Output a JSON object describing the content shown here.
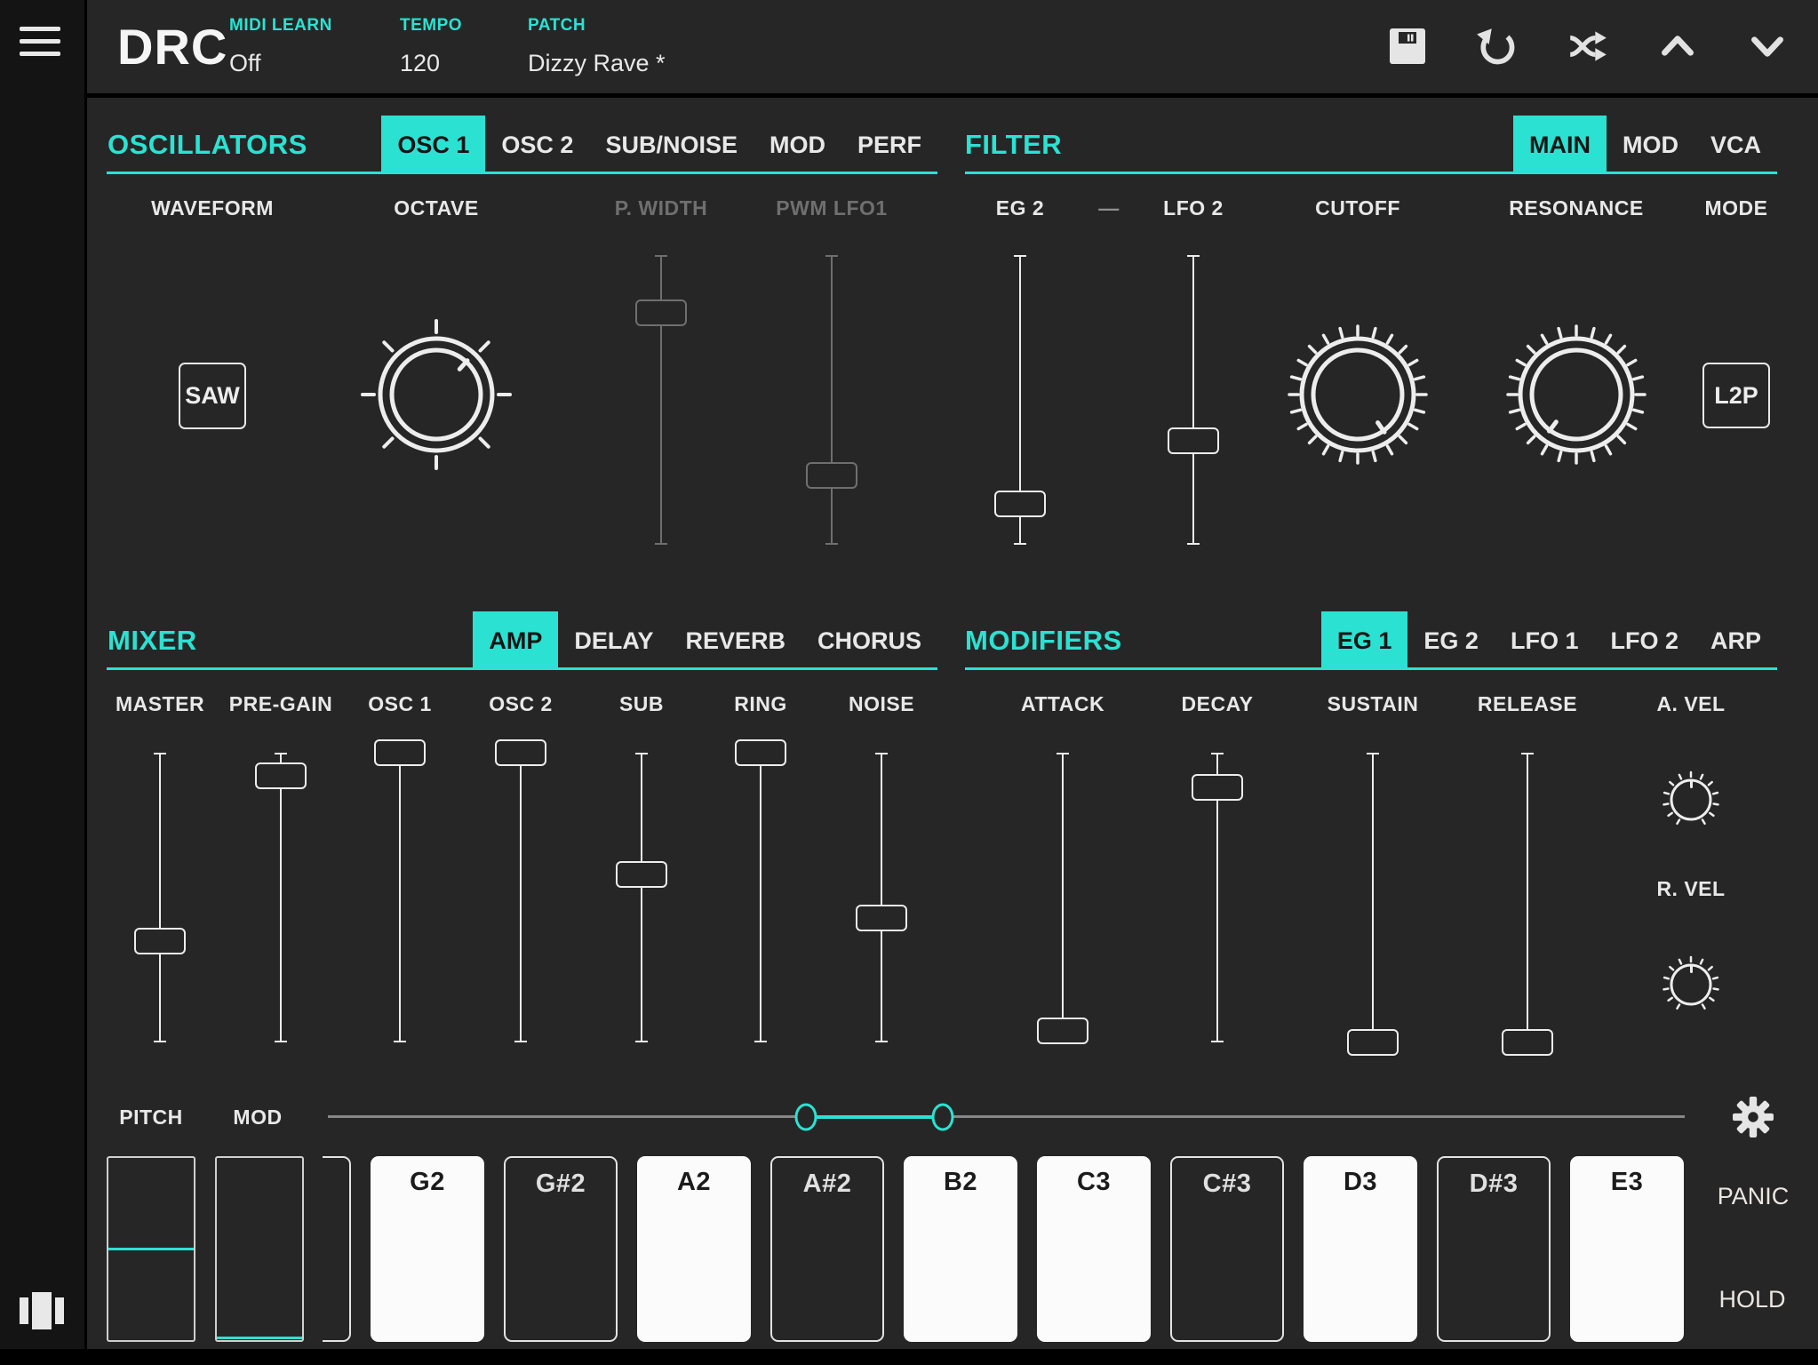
{
  "app": {
    "logo": "DRC"
  },
  "topbar": {
    "fields": [
      {
        "label": "MIDI LEARN",
        "value": "Off"
      },
      {
        "label": "TEMPO",
        "value": "120"
      },
      {
        "label": "PATCH",
        "value": "Dizzy Rave *"
      }
    ],
    "icons": [
      "save-icon",
      "undo-icon",
      "shuffle-icon",
      "chevron-up-icon",
      "chevron-down-icon"
    ]
  },
  "colors": {
    "accent": "#2be2d2",
    "panel": "#262626",
    "sidebar": "#141414",
    "text": "#ededed",
    "dim": "#6f6f6f",
    "key_white": "#fbfbfb"
  },
  "oscillators": {
    "title": "OSCILLATORS",
    "tabs": [
      {
        "label": "OSC 1",
        "active": true
      },
      {
        "label": "OSC 2",
        "active": false
      },
      {
        "label": "SUB/NOISE",
        "active": false
      },
      {
        "label": "MOD",
        "active": false
      },
      {
        "label": "PERF",
        "active": false
      }
    ],
    "waveform": {
      "label": "WAVEFORM",
      "value": "SAW"
    },
    "octave": {
      "label": "OCTAVE",
      "angle": "42deg"
    },
    "p_width": {
      "label": "P. WIDTH",
      "pos": "20%",
      "disabled": true
    },
    "pwm_lfo1": {
      "label": "PWM LFO1",
      "pos": "76%",
      "disabled": true
    }
  },
  "filter": {
    "title": "FILTER",
    "tabs": [
      {
        "label": "MAIN",
        "active": true
      },
      {
        "label": "MOD",
        "active": false
      },
      {
        "label": "VCA",
        "active": false
      }
    ],
    "eg2": {
      "label": "EG 2",
      "pos": "86%"
    },
    "dash": "—",
    "lfo2": {
      "label": "LFO 2",
      "pos": "64%"
    },
    "cutoff": {
      "label": "CUTOFF",
      "angle": "145deg"
    },
    "resonance": {
      "label": "RESONANCE",
      "angle": "217deg"
    },
    "mode": {
      "label": "MODE",
      "value": "L2P"
    }
  },
  "mixer": {
    "title": "MIXER",
    "tabs": [
      {
        "label": "AMP",
        "active": true
      },
      {
        "label": "DELAY",
        "active": false
      },
      {
        "label": "REVERB",
        "active": false
      },
      {
        "label": "CHORUS",
        "active": false
      }
    ],
    "sliders": [
      {
        "label": "MASTER",
        "pos": "65%"
      },
      {
        "label": "PRE-GAIN",
        "pos": "8%"
      },
      {
        "label": "OSC 1",
        "pos": "0%"
      },
      {
        "label": "OSC 2",
        "pos": "0%"
      },
      {
        "label": "SUB",
        "pos": "42%"
      },
      {
        "label": "RING",
        "pos": "0%"
      },
      {
        "label": "NOISE",
        "pos": "57%"
      }
    ]
  },
  "modifiers": {
    "title": "MODIFIERS",
    "tabs": [
      {
        "label": "EG 1",
        "active": true
      },
      {
        "label": "EG 2",
        "active": false
      },
      {
        "label": "LFO 1",
        "active": false
      },
      {
        "label": "LFO 2",
        "active": false
      },
      {
        "label": "ARP",
        "active": false
      }
    ],
    "sliders": [
      {
        "label": "ATTACK",
        "pos": "96%"
      },
      {
        "label": "DECAY",
        "pos": "12%"
      },
      {
        "label": "SUSTAIN",
        "pos": "100%"
      },
      {
        "label": "RELEASE",
        "pos": "100%"
      }
    ],
    "a_vel": {
      "label": "A. VEL",
      "angle": "0deg"
    },
    "r_vel": {
      "label": "R. VEL",
      "angle": "0deg"
    }
  },
  "performance": {
    "pitch_label": "PITCH",
    "mod_label": "MOD",
    "range": {
      "start": "35.2%",
      "end": "45.3%"
    },
    "pitch_wheel_pos": "50%",
    "mod_wheel_pos": "99%",
    "panic": "PANIC",
    "hold": "HOLD"
  },
  "keyboard": {
    "keys": [
      {
        "label": "",
        "type": "black"
      },
      {
        "label": "G2",
        "type": "white"
      },
      {
        "label": "G#2",
        "type": "black"
      },
      {
        "label": "A2",
        "type": "white"
      },
      {
        "label": "A#2",
        "type": "black"
      },
      {
        "label": "B2",
        "type": "white"
      },
      {
        "label": "C3",
        "type": "white"
      },
      {
        "label": "C#3",
        "type": "black"
      },
      {
        "label": "D3",
        "type": "white"
      },
      {
        "label": "D#3",
        "type": "black"
      },
      {
        "label": "E3",
        "type": "white"
      }
    ]
  }
}
